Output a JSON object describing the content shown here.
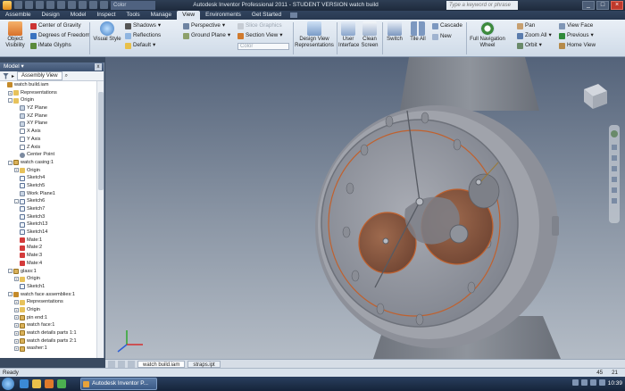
{
  "window": {
    "title": "Autodesk Inventor Professional 2011  -  STUDENT VERSION    watch build",
    "color_box": "Color",
    "search_placeholder": "Type a keyword or phrase"
  },
  "tabs": [
    "Assemble",
    "Design",
    "Model",
    "Inspect",
    "Tools",
    "Manage",
    "View",
    "Environments",
    "Get Started"
  ],
  "active_tab": "View",
  "ribbon": {
    "object_visibility": "Object Visibility",
    "center_of_gravity": "Center of Gravity",
    "degrees_of_freedom": "Degrees of Freedom",
    "imate_glyphs": "iMate Glyphs",
    "visual_style": "Visual Style",
    "shadows": "Shadows",
    "reflections": "Reflections",
    "default": "Default",
    "perspective": "Perspective",
    "ground_plane": "Ground Plane",
    "slice_graphics": "Slice Graphics",
    "section_view": "Section View",
    "color_dd": "Color",
    "design_view_representations": "Design View Representations",
    "user_interface": "User Interface",
    "clean_screen": "Clean Screen",
    "switch": "Switch",
    "tile_all": "Tile All",
    "cascade": "Cascade",
    "new": "New",
    "full_navigation_wheel": "Full Navigation Wheel",
    "pan": "Pan",
    "zoom_all": "Zoom All",
    "orbit": "Orbit",
    "view_face": "View Face",
    "previous": "Previous",
    "home_view": "Home View"
  },
  "model_panel": {
    "title": "Model",
    "close": "x",
    "assembly_view": "Assembly View"
  },
  "tree": [
    {
      "label": "watch build.iam",
      "icon": "asm",
      "depth": 0,
      "pm": ""
    },
    {
      "label": "Representations",
      "icon": "fold",
      "depth": 1,
      "pm": "+"
    },
    {
      "label": "Origin",
      "icon": "fold",
      "depth": 1,
      "pm": "-"
    },
    {
      "label": "YZ Plane",
      "icon": "plane",
      "depth": 2,
      "pm": ""
    },
    {
      "label": "XZ Plane",
      "icon": "plane",
      "depth": 2,
      "pm": ""
    },
    {
      "label": "XY Plane",
      "icon": "plane",
      "depth": 2,
      "pm": ""
    },
    {
      "label": "X Axis",
      "icon": "axis",
      "depth": 2,
      "pm": ""
    },
    {
      "label": "Y Axis",
      "icon": "axis",
      "depth": 2,
      "pm": ""
    },
    {
      "label": "Z Axis",
      "icon": "axis",
      "depth": 2,
      "pm": ""
    },
    {
      "label": "Center Point",
      "icon": "pt",
      "depth": 2,
      "pm": ""
    },
    {
      "label": "watch casing:1",
      "icon": "part",
      "depth": 1,
      "pm": "-"
    },
    {
      "label": "Origin",
      "icon": "fold",
      "depth": 2,
      "pm": "+"
    },
    {
      "label": "Sketch4",
      "icon": "sk",
      "depth": 2,
      "pm": ""
    },
    {
      "label": "Sketch5",
      "icon": "sk",
      "depth": 2,
      "pm": ""
    },
    {
      "label": "Work Plane1",
      "icon": "plane",
      "depth": 2,
      "pm": ""
    },
    {
      "label": "Sketch6",
      "icon": "sk",
      "depth": 2,
      "pm": "-"
    },
    {
      "label": "Sketch7",
      "icon": "sk",
      "depth": 2,
      "pm": ""
    },
    {
      "label": "Sketch3",
      "icon": "sk",
      "depth": 2,
      "pm": ""
    },
    {
      "label": "Sketch13",
      "icon": "sk",
      "depth": 2,
      "pm": ""
    },
    {
      "label": "Sketch14",
      "icon": "sk",
      "depth": 2,
      "pm": ""
    },
    {
      "label": "Mate:1",
      "icon": "mate",
      "depth": 2,
      "pm": ""
    },
    {
      "label": "Mate:2",
      "icon": "mate",
      "depth": 2,
      "pm": ""
    },
    {
      "label": "Mate:3",
      "icon": "mate",
      "depth": 2,
      "pm": ""
    },
    {
      "label": "Mate:4",
      "icon": "mate",
      "depth": 2,
      "pm": ""
    },
    {
      "label": "glass:1",
      "icon": "part",
      "depth": 1,
      "pm": "-"
    },
    {
      "label": "Origin",
      "icon": "fold",
      "depth": 2,
      "pm": "+"
    },
    {
      "label": "Sketch1",
      "icon": "sk",
      "depth": 2,
      "pm": ""
    },
    {
      "label": "watch face assemblies:1",
      "icon": "asm",
      "depth": 1,
      "pm": "-"
    },
    {
      "label": "Representations",
      "icon": "fold",
      "depth": 2,
      "pm": "+"
    },
    {
      "label": "Origin",
      "icon": "fold",
      "depth": 2,
      "pm": "+"
    },
    {
      "label": "pin end:1",
      "icon": "part",
      "depth": 2,
      "pm": "+"
    },
    {
      "label": "watch face:1",
      "icon": "part",
      "depth": 2,
      "pm": "+"
    },
    {
      "label": "watch details parts 1:1",
      "icon": "part",
      "depth": 2,
      "pm": "+"
    },
    {
      "label": "watch details parts 2:1",
      "icon": "part",
      "depth": 2,
      "pm": "+"
    },
    {
      "label": "washer:1",
      "icon": "part",
      "depth": 2,
      "pm": "+"
    }
  ],
  "doc_tabs": [
    {
      "label": "watch build.iam",
      "active": true
    },
    {
      "label": "straps.ipt",
      "active": false
    }
  ],
  "status": {
    "text": "Ready",
    "n1": "45",
    "n2": "21"
  },
  "taskbar": {
    "task_label": "Autodesk Inventor P...",
    "clock": "10:39"
  },
  "colors": {
    "accent": "#c0612e",
    "casing": "#9a9ca4",
    "copper": "#b4633a"
  }
}
